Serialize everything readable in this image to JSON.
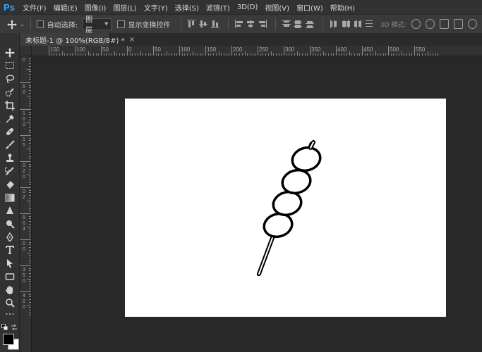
{
  "app": {
    "logo": "Ps"
  },
  "menu": [
    "文件(F)",
    "编辑(E)",
    "图像(I)",
    "图层(L)",
    "文字(Y)",
    "选择(S)",
    "滤镜(T)",
    "3D(D)",
    "视图(V)",
    "窗口(W)",
    "帮助(H)"
  ],
  "options": {
    "auto_select_label": "自动选择:",
    "auto_select_value": "图层",
    "show_transform_label": "显示变换控件",
    "mode_3d_label": "3D 模式:"
  },
  "document": {
    "tab_title": "未标题-1 @ 100%(RGB/8#) *",
    "close": "×"
  },
  "ruler_top": [
    "150",
    "100",
    "50",
    "0",
    "50",
    "100",
    "150",
    "200",
    "250",
    "300",
    "350",
    "400",
    "450",
    "500",
    "550"
  ],
  "ruler_left": [
    "0",
    "5",
    "0",
    "1",
    "0",
    "0",
    "1",
    "5",
    "0",
    "2",
    "0",
    "0",
    "2",
    "5",
    "0",
    "3",
    "0",
    "0",
    "3",
    "5",
    "0",
    "4",
    "0",
    "0"
  ],
  "colors": {
    "foreground": "#000000",
    "background": "#ffffff",
    "canvas": "#ffffff",
    "accent": "#31a8ff"
  },
  "tools": [
    "move-tool",
    "marquee-tool",
    "lasso-tool",
    "quick-select-tool",
    "crop-tool",
    "eyedropper-tool",
    "healing-brush-tool",
    "brush-tool",
    "clone-stamp-tool",
    "history-brush-tool",
    "eraser-tool",
    "gradient-tool",
    "blur-tool",
    "dodge-tool",
    "pen-tool",
    "type-tool",
    "path-select-tool",
    "rectangle-tool",
    "hand-tool",
    "zoom-tool",
    "more-tools"
  ],
  "tool_glyphs": [
    "✥",
    "⬚",
    "ʘ",
    "✎",
    "⌗",
    "✐",
    "✚",
    "✏",
    "♙",
    "⟲",
    "◩",
    "▭",
    "▲",
    "●",
    "✒",
    "T",
    "➤",
    "▢",
    "✋",
    "⚲"
  ]
}
